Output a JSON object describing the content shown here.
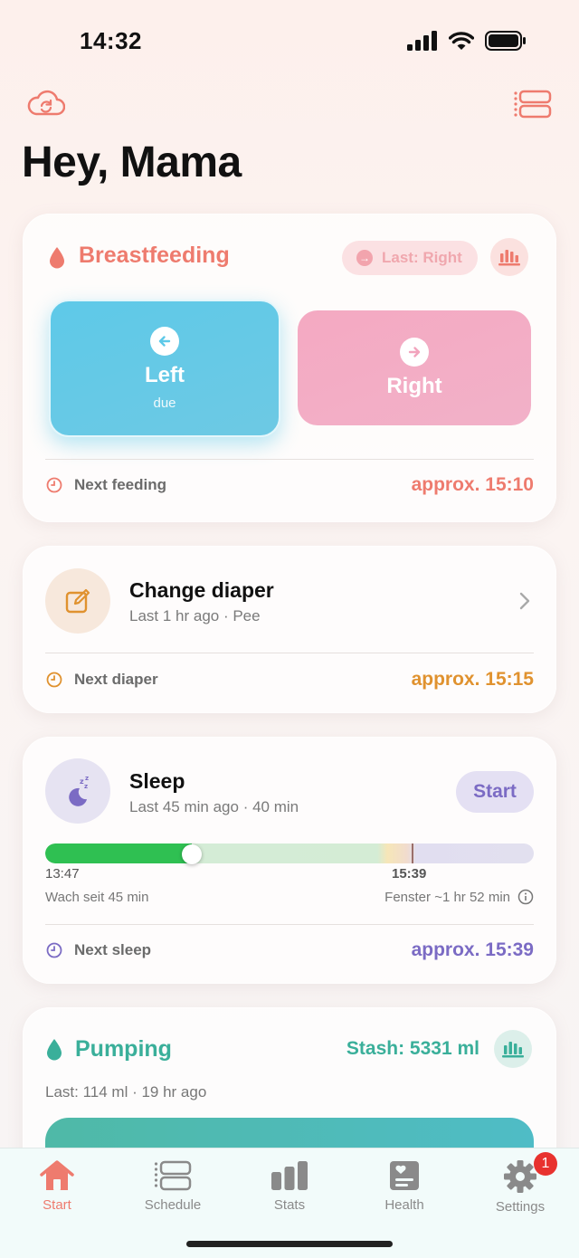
{
  "status_bar": {
    "time": "14:32"
  },
  "greeting": "Hey, Mama",
  "breastfeeding": {
    "title": "Breastfeeding",
    "last_pill": "Last: Right",
    "left": {
      "label": "Left",
      "sub": "due"
    },
    "right": {
      "label": "Right"
    },
    "footer_label": "Next feeding",
    "footer_value": "approx. 15:10"
  },
  "diaper": {
    "title": "Change diaper",
    "subtitle": "Last 1 hr ago · Pee",
    "footer_label": "Next diaper",
    "footer_value": "approx. 15:15"
  },
  "sleep": {
    "title": "Sleep",
    "subtitle": "Last 45 min ago · 40 min",
    "start_label": "Start",
    "timeline": {
      "start_time": "13:47",
      "marker_time": "15:39",
      "progress": 0.3,
      "marker": 0.75,
      "left_caption": "Wach seit 45 min",
      "right_caption": "Fenster ~1 hr 52 min"
    },
    "footer_label": "Next sleep",
    "footer_value": "approx. 15:39"
  },
  "pumping": {
    "title": "Pumping",
    "stash": "Stash: 5331 ml",
    "last": "Last: 114 ml · 19 hr ago"
  },
  "tabbar": {
    "tabs": [
      {
        "label": "Start",
        "icon": "home-icon",
        "active": true
      },
      {
        "label": "Schedule",
        "icon": "schedule-icon"
      },
      {
        "label": "Stats",
        "icon": "stats-icon"
      },
      {
        "label": "Health",
        "icon": "health-icon"
      },
      {
        "label": "Settings",
        "icon": "gear-icon",
        "badge": "1"
      }
    ]
  },
  "colors": {
    "feeding": "#ee7b6e",
    "diaper": "#e0922f",
    "sleep": "#7b6bc4",
    "pumping": "#3aaf9a",
    "left_button": "#5ec9e8",
    "right_button": "#f4a9c2"
  }
}
